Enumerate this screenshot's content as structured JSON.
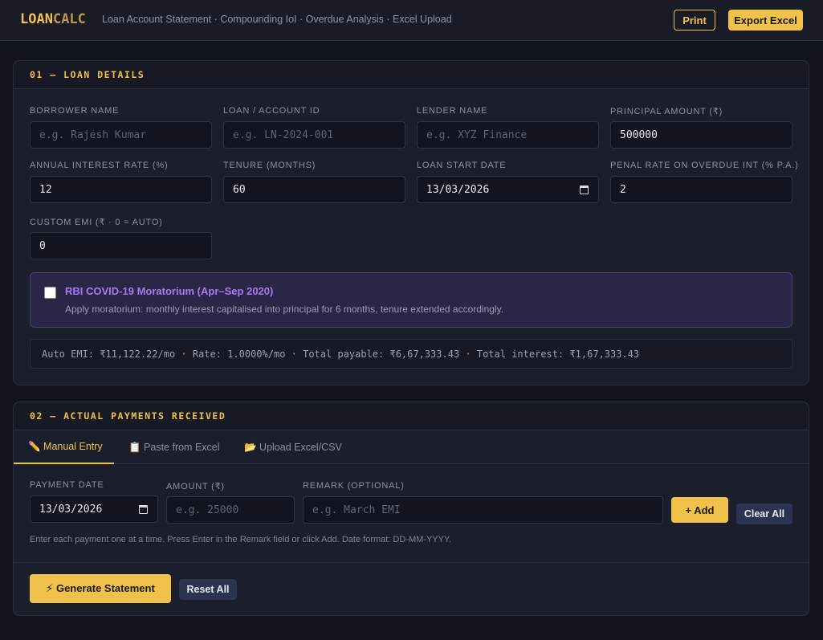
{
  "header": {
    "logo_a": "LOAN",
    "logo_b": "CALC",
    "tagline": "Loan Account Statement · Compounding IoI · Overdue Analysis · Excel Upload",
    "print_label": "Print",
    "export_label": "Export Excel"
  },
  "loan_details": {
    "section_title": "01 — LOAN DETAILS",
    "borrower_label": "Borrower Name",
    "borrower_placeholder": "e.g. Rajesh Kumar",
    "account_label": "Loan / Account ID",
    "account_placeholder": "e.g. LN-2024-001",
    "lender_label": "Lender Name",
    "lender_placeholder": "e.g. XYZ Finance",
    "principal_label": "Principal Amount (₹)",
    "principal_value": "500000",
    "rate_label": "Annual Interest Rate (%)",
    "rate_value": "12",
    "tenure_label": "Tenure (Months)",
    "tenure_value": "60",
    "start_label": "Loan Start Date",
    "start_value": "13/03/2026",
    "penal_label": "Penal Rate on Overdue Int (% p.a.)",
    "penal_value": "2",
    "emi_label": "Custom EMI (₹ · 0 = Auto)",
    "emi_value": "0",
    "moratorium_title": "RBI COVID-19 Moratorium (Apr–Sep 2020)",
    "moratorium_desc": "Apply moratorium: monthly interest capitalised into principal for 6 months, tenure extended accordingly.",
    "summary": "Auto EMI: ₹11,122.22/mo · Rate: 1.0000%/mo · Total payable: ₹6,67,333.43 · Total interest: ₹1,67,333.43"
  },
  "payments": {
    "section_title": "02 — ACTUAL PAYMENTS RECEIVED",
    "tabs": [
      "✏️ Manual Entry",
      "📋 Paste from Excel",
      "📂 Upload Excel/CSV"
    ],
    "date_label": "Payment Date",
    "date_value": "13/03/2026",
    "amount_label": "Amount (₹)",
    "amount_placeholder": "e.g. 25000",
    "remark_label": "Remark (optional)",
    "remark_placeholder": "e.g. March EMI",
    "add_label": "+ Add",
    "clear_label": "Clear All",
    "hint": "Enter each payment one at a time. Press Enter in the Remark field or click Add. Date format: DD-MM-YYYY.",
    "generate_label": "⚡ Generate Statement",
    "reset_label": "Reset All"
  },
  "colors": {
    "accent": "#f0c14b",
    "purple": "#a47bf3",
    "bg": "#13151d"
  }
}
